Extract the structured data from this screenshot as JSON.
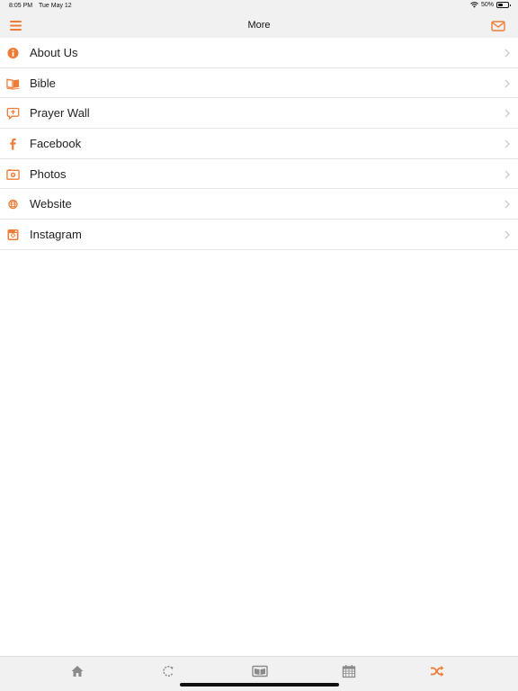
{
  "status_bar": {
    "time": "8:05 PM",
    "date": "Tue May 12",
    "battery": "50%",
    "battery_level": 0.5
  },
  "header": {
    "title": "More",
    "menu_icon": "hamburger-icon",
    "mail_icon": "mail-icon"
  },
  "menu": {
    "items": [
      {
        "label": "About Us",
        "icon": "info-icon"
      },
      {
        "label": "Bible",
        "icon": "bible-icon"
      },
      {
        "label": "Prayer Wall",
        "icon": "prayer-wall-icon"
      },
      {
        "label": "Facebook",
        "icon": "facebook-icon"
      },
      {
        "label": "Photos",
        "icon": "photos-icon"
      },
      {
        "label": "Website",
        "icon": "globe-icon"
      },
      {
        "label": "Instagram",
        "icon": "instagram-icon"
      }
    ]
  },
  "tab_bar": {
    "tabs": [
      {
        "icon": "home-icon",
        "active": false
      },
      {
        "icon": "refresh-icon",
        "active": false
      },
      {
        "icon": "bible-tab-icon",
        "active": false
      },
      {
        "icon": "calendar-icon",
        "active": false
      },
      {
        "icon": "shuffle-icon",
        "active": true
      }
    ]
  },
  "colors": {
    "accent": "#f07b34",
    "bar_background": "#f1f1f1",
    "tab_inactive": "#8a8a8a",
    "chevron": "#c4c4c4",
    "divider": "#e4e4e4"
  }
}
